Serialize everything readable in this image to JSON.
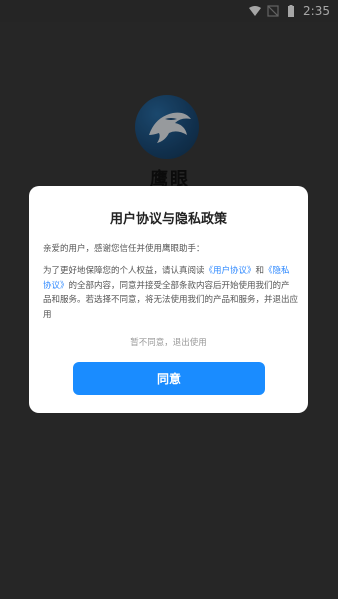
{
  "status_bar": {
    "time": "2:35"
  },
  "app": {
    "name": "鹰眼"
  },
  "dialog": {
    "title": "用户协议与隐私政策",
    "greeting": "亲爱的用户，感谢您信任并使用鹰眼助手：",
    "body_part1": "为了更好地保障您的个人权益，请认真阅读",
    "user_agreement_link": "《用户协议》",
    "body_part2": "和",
    "privacy_policy_link": "《隐私协议》",
    "body_part3": "的全部内容，同意并接受全部条款内容后开始使用我们的产品和服务。若选择不同意，将无法使用我们的产品和服务，并退出应用",
    "disagree_label": "暂不同意，退出使用",
    "agree_label": "同意"
  },
  "colors": {
    "accent": "#1a8cff",
    "link": "#2d88ff"
  }
}
